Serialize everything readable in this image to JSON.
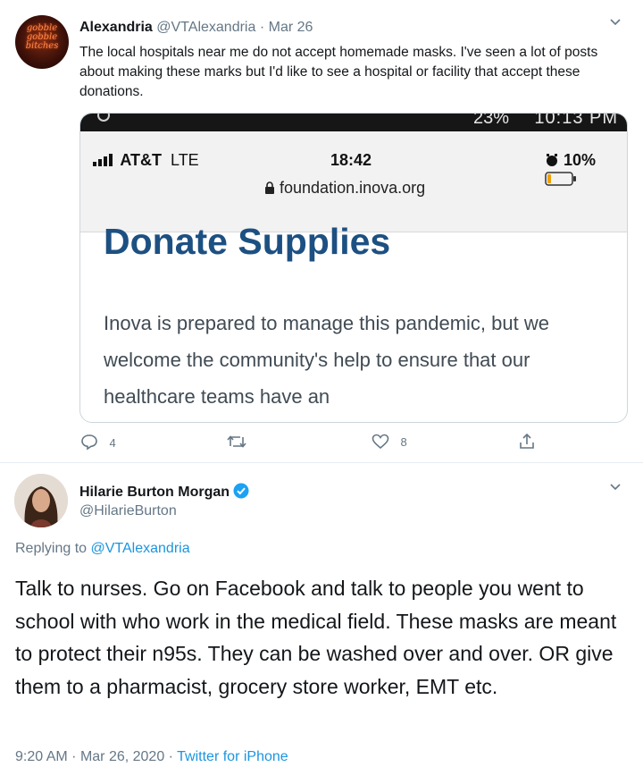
{
  "tweet1": {
    "avatar_text": "gobble gobble bitches",
    "name": "Alexandria",
    "handle": "@VTAlexandria",
    "separator": "·",
    "date": "Mar 26",
    "text": "The local hospitals near me do not accept homemade masks. I've seen a lot of posts about making these marks but I'd like to see a hospital or facility that accept these donations.",
    "media": {
      "top_battery": "23%",
      "top_time": "10:13 PM",
      "carrier": "AT&T",
      "network": "LTE",
      "clock": "18:42",
      "battery": "10%",
      "url": "foundation.inova.org",
      "heading": "Donate Supplies",
      "body": "Inova is prepared to manage this pandemic, but we welcome the community's help to ensure that our healthcare teams have an"
    },
    "actions": {
      "reply_count": "4",
      "retweet_count": "",
      "like_count": "8"
    }
  },
  "tweet2": {
    "name": "Hilarie Burton Morgan",
    "handle": "@HilarieBurton",
    "replying_prefix": "Replying to",
    "replying_to": "@VTAlexandria",
    "text": "Talk to nurses. Go on Facebook and talk to people you went to school with who work in the medical field. These masks are meant to protect their n95s. They can be washed over and over. OR give them to a pharmacist, grocery store worker, EMT etc.",
    "time": "9:20 AM",
    "sep1": "·",
    "date": "Mar 26, 2020",
    "sep2": "·",
    "source": "Twitter for iPhone"
  },
  "colors": {
    "link": "#1b95e0",
    "muted": "#657786",
    "verified": "#1da1f2",
    "heading": "#1d5082"
  }
}
